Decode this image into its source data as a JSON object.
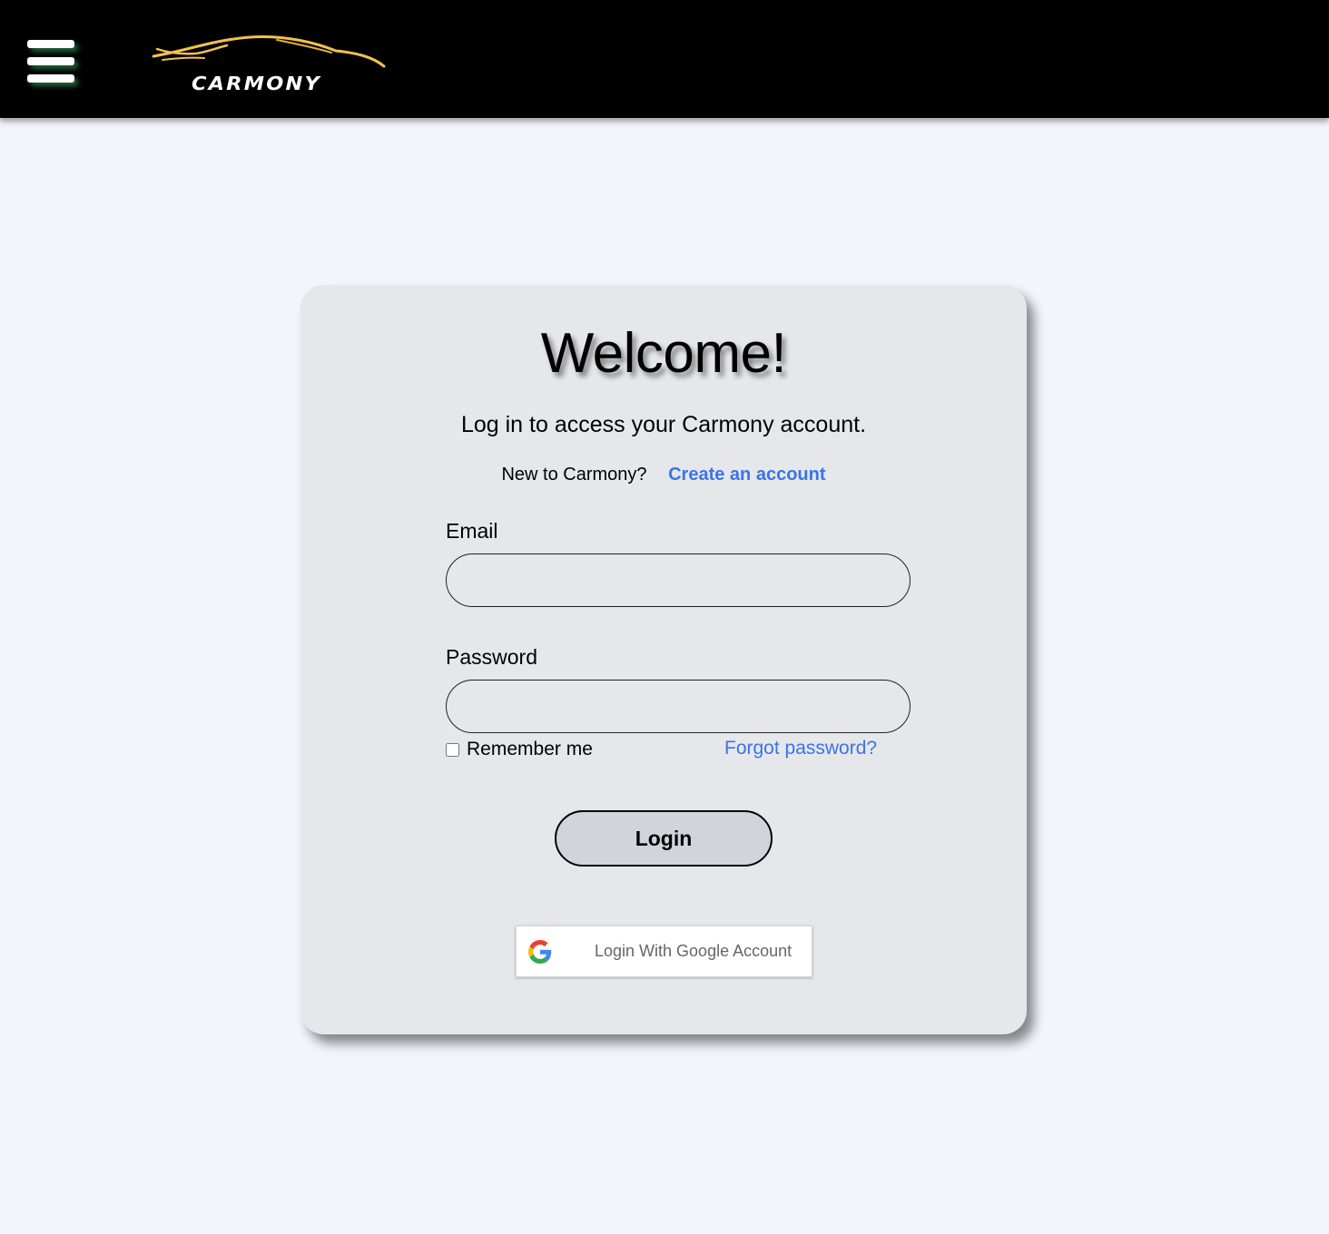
{
  "header": {
    "menu_icon": "hamburger-menu-icon",
    "brand_name": "CARMONY",
    "logo_accent": "#f2c14e"
  },
  "login_card": {
    "title": "Welcome!",
    "subtitle": "Log in to access your Carmony account.",
    "signup_prompt": "New to Carmony?",
    "signup_link": "Create an account",
    "email_label": "Email",
    "email_value": "",
    "password_label": "Password",
    "password_value": "",
    "remember_label": "Remember me",
    "remember_checked": false,
    "forgot_link": "Forgot password?",
    "login_button": "Login",
    "google_button": "Login With Google Account",
    "google_icon": "google-g-icon"
  },
  "colors": {
    "link": "#3b74e8",
    "background": "#f2f5fc",
    "card": "#e5e7eb",
    "header": "#000000"
  }
}
